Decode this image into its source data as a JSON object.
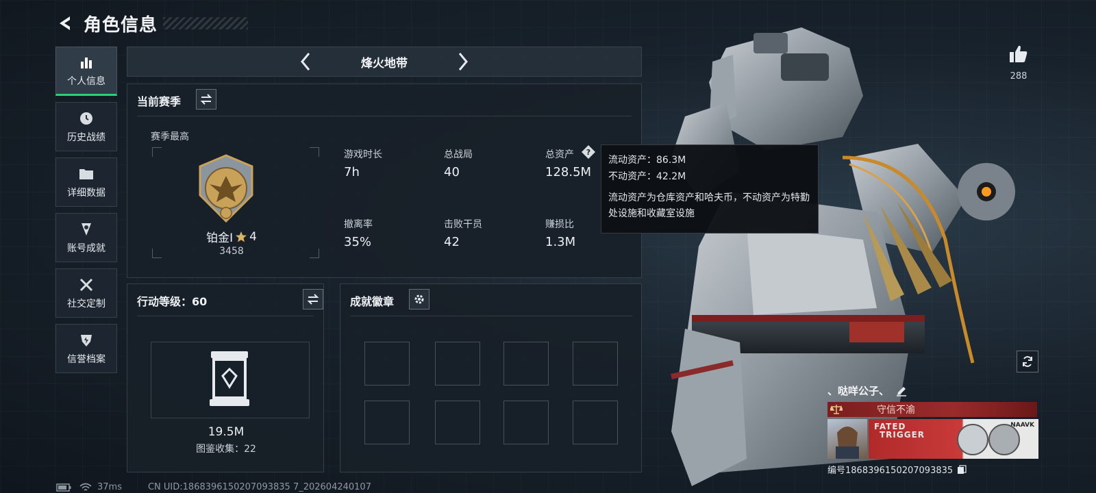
{
  "header": {
    "title": "角色信息"
  },
  "sidebar": {
    "items": [
      {
        "label": "个人信息",
        "icon": "bar-chart-icon"
      },
      {
        "label": "历史战绩",
        "icon": "clock-icon"
      },
      {
        "label": "详细数据",
        "icon": "folder-icon"
      },
      {
        "label": "账号成就",
        "icon": "trophy-icon"
      },
      {
        "label": "社交定制",
        "icon": "tools-icon"
      },
      {
        "label": "信誉档案",
        "icon": "shield-icon"
      }
    ],
    "active_index": 0
  },
  "mode": {
    "name": "烽火地带"
  },
  "season": {
    "title": "当前赛季",
    "best_label": "赛季最高",
    "rank_name": "铂金I",
    "rank_stars": "4",
    "rank_score": "3458"
  },
  "stats": [
    {
      "label": "游戏时长",
      "value": "7h"
    },
    {
      "label": "总战局",
      "value": "40"
    },
    {
      "label": "总资产",
      "value": "128.5M"
    },
    {
      "label": "撤离率",
      "value": "35%"
    },
    {
      "label": "击败干员",
      "value": "42"
    },
    {
      "label": "赚损比",
      "value": "1.3M"
    }
  ],
  "tooltip": {
    "liquid": "流动资产：86.3M",
    "fixed": "不动资产：42.2M",
    "desc": "流动资产为仓库资产和哈夫币，不动资产为特勤处设施和收藏室设施"
  },
  "action_level": {
    "title": "行动等级：60",
    "value": "19.5M",
    "collection": "图鉴收集：22"
  },
  "achievements": {
    "title": "成就徽章"
  },
  "likes": {
    "count": "288"
  },
  "player": {
    "name": "、哒咩公子、",
    "honor": "守信不渝",
    "banner_text_1": "FATED",
    "banner_text_2": "TRIGGER",
    "banner_brand": "NAAVK",
    "uid": "编号1868396150207093835"
  },
  "footer": {
    "ping": "37ms",
    "uid": "CN UID:1868396150207093835 7_202604240107"
  },
  "colors": {
    "accent_green": "#2ad17a",
    "honor_red": "#9a2b2b",
    "rank_gold": "#c9a25a"
  }
}
